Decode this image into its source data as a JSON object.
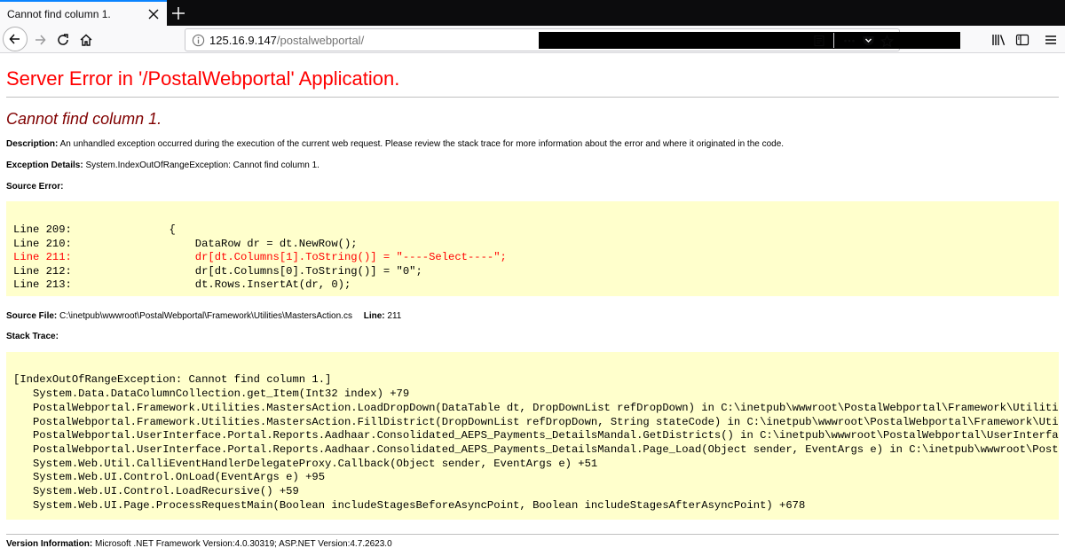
{
  "browser": {
    "tab_title": "Cannot find column 1.",
    "url_host": "125.16.9.147",
    "url_path": "/postalwebportal/"
  },
  "page": {
    "heading": "Server Error in '/PostalWebportal' Application.",
    "error_title": "Cannot find column 1.",
    "description_label": "Description:",
    "description_text": "An unhandled exception occurred during the execution of the current web request. Please review the stack trace for more information about the error and where it originated in the code.",
    "exception_label": "Exception Details:",
    "exception_text": "System.IndexOutOfRangeException: Cannot find column 1.",
    "source_error_label": "Source Error:",
    "source_lines": [
      "Line 209:               {",
      "Line 210:                   DataRow dr = dt.NewRow();",
      "Line 211:                   dr[dt.Columns[1].ToString()] = \"----Select----\";",
      "Line 212:                   dr[dt.Columns[0].ToString()] = \"0\";",
      "Line 213:                   dt.Rows.InsertAt(dr, 0);"
    ],
    "source_file_label": "Source File:",
    "source_file_text": "C:\\inetpub\\wwwroot\\PostalWebportal\\Framework\\Utilities\\MastersAction.cs",
    "line_label": "Line:",
    "line_value": "211",
    "stack_trace_label": "Stack Trace:",
    "stack_lines": [
      "[IndexOutOfRangeException: Cannot find column 1.]",
      "   System.Data.DataColumnCollection.get_Item(Int32 index) +79",
      "   PostalWebportal.Framework.Utilities.MastersAction.LoadDropDown(DataTable dt, DropDownList refDropDown) in C:\\inetpub\\wwwroot\\PostalWebportal\\Framework\\Utilitie",
      "   PostalWebportal.Framework.Utilities.MastersAction.FillDistrict(DropDownList refDropDown, String stateCode) in C:\\inetpub\\wwwroot\\PostalWebportal\\Framework\\Util",
      "   PostalWebportal.UserInterface.Portal.Reports.Aadhaar.Consolidated_AEPS_Payments_DetailsMandal.GetDistricts() in C:\\inetpub\\wwwroot\\PostalWebportal\\UserInterfac",
      "   PostalWebportal.UserInterface.Portal.Reports.Aadhaar.Consolidated_AEPS_Payments_DetailsMandal.Page_Load(Object sender, EventArgs e) in C:\\inetpub\\wwwroot\\Posta",
      "   System.Web.Util.CalliEventHandlerDelegateProxy.Callback(Object sender, EventArgs e) +51",
      "   System.Web.UI.Control.OnLoad(EventArgs e) +95",
      "   System.Web.UI.Control.LoadRecursive() +59",
      "   System.Web.UI.Page.ProcessRequestMain(Boolean includeStagesBeforeAsyncPoint, Boolean includeStagesAfterAsyncPoint) +678"
    ],
    "version_label": "Version Information:",
    "version_text": "Microsoft .NET Framework Version:4.0.30319; ASP.NET Version:4.7.2623.0"
  }
}
